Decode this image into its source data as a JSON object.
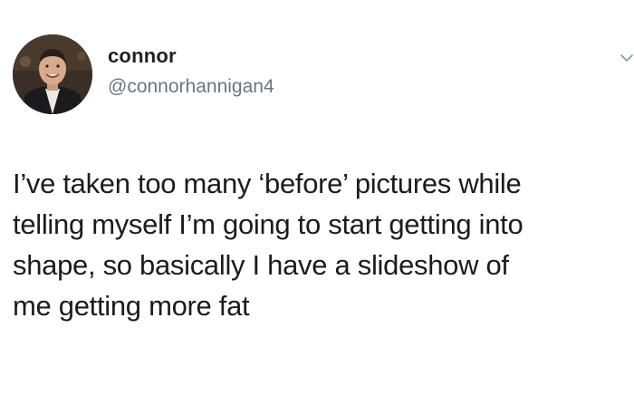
{
  "user": {
    "display_name": "connor",
    "handle": "@connorhannigan4",
    "avatar_icon": "profile-photo"
  },
  "tweet": {
    "lines": [
      "I’ve taken too many ‘before’ pictures while",
      "telling myself I’m going to start getting into",
      "shape, so basically I have a slideshow of",
      "me getting more fat"
    ]
  },
  "icons": {
    "menu": "chevron-down-icon"
  },
  "colors": {
    "background": "#ffffff",
    "text": "#1c1c1c",
    "handle": "#657786"
  }
}
